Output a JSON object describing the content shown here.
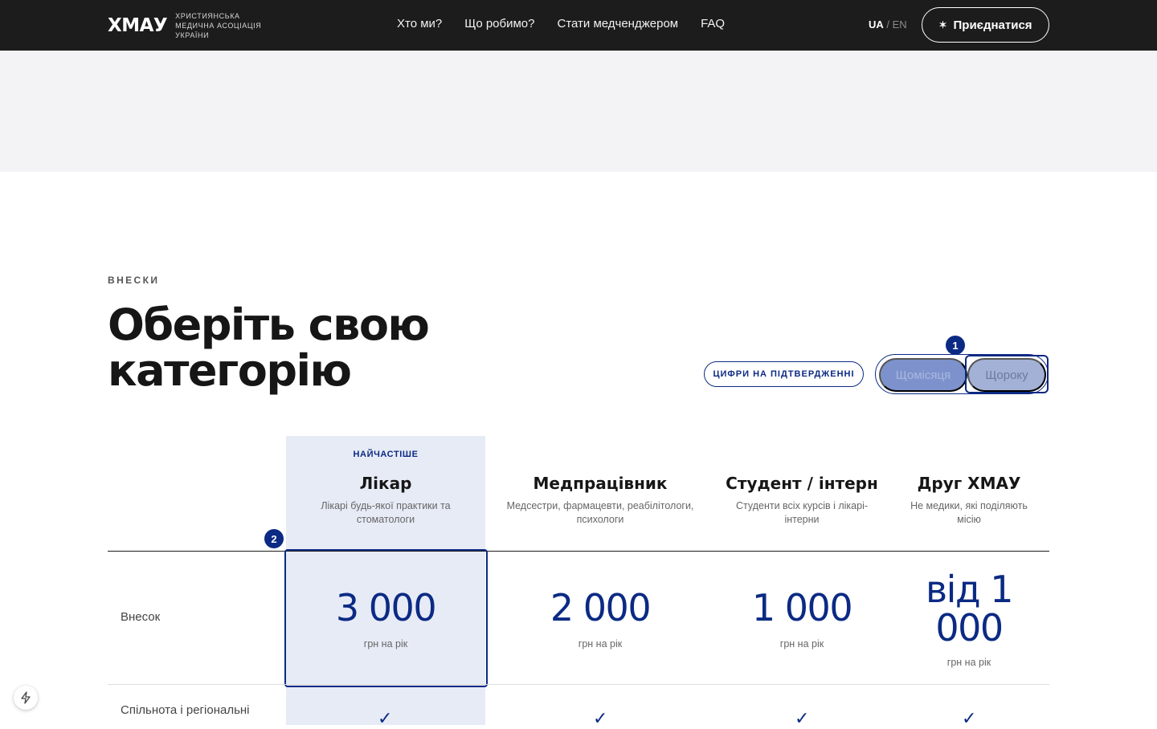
{
  "header": {
    "logo": "ХМАУ",
    "logo_sub": [
      "ХРИСТИЯНСЬКА",
      "МЕДИЧНА АСОЦІАЦІЯ",
      "УКРАЇНИ"
    ],
    "nav": [
      "Хто ми?",
      "Що робимо?",
      "Стати медченджером",
      "FAQ"
    ],
    "lang_active": "UA",
    "lang_sep": " / ",
    "lang_other": "EN",
    "join_icon": "✶",
    "join_label": "Приєднатися"
  },
  "section": {
    "eyebrow": "ВНЕСКИ",
    "title": "Оберіть свою категорію",
    "verify_pill": "ЦИФРИ НА ПІДТВЕРДЖЕННІ",
    "toggle": {
      "monthly": "Щомісяця",
      "yearly": "Щороку"
    },
    "markers": [
      "1",
      "2"
    ]
  },
  "plans": [
    {
      "badge": "НАЙЧАСТІШЕ",
      "name": "Лікар",
      "desc": "Лікарі будь-якої практики та стоматологи",
      "price": "3 000",
      "unit": "грн на рік"
    },
    {
      "badge": "",
      "name": "Медпрацівник",
      "desc": "Медсестри, фармацевти, реабілітологи, психологи",
      "price": "2 000",
      "unit": "грн на рік"
    },
    {
      "badge": "",
      "name": "Студент / інтерн",
      "desc": "Студенти всіх курсів і лікарі-інтерни",
      "price": "1 000",
      "unit": "грн на рік"
    },
    {
      "badge": "",
      "name": "Друг ХМАУ",
      "desc": "Не медики, які поділяють місію",
      "price": "від 1 000",
      "unit": "грн на рік"
    }
  ],
  "rows": {
    "fee_label": "Внесок",
    "community_label": "Спільнота і регіональні",
    "check": "✓"
  },
  "colors": {
    "accent": "#0b2a84",
    "header_bg": "#1c1c1c",
    "highlight": "#e7ebf6"
  }
}
